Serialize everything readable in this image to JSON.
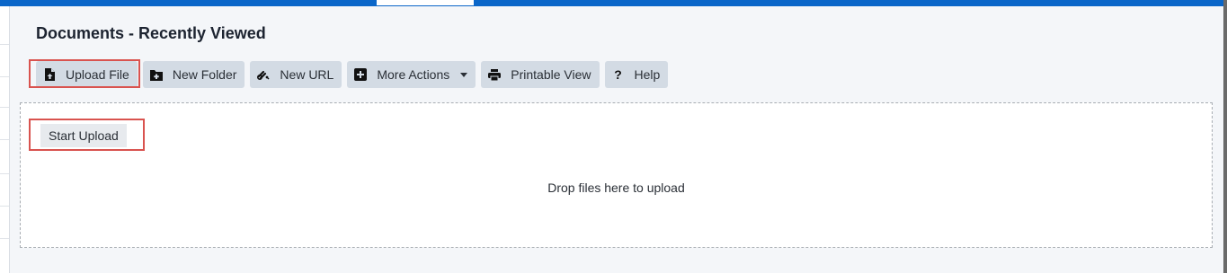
{
  "header": {
    "title": "Documents - Recently Viewed"
  },
  "toolbar": {
    "upload_file": "Upload File",
    "new_folder": "New Folder",
    "new_url": "New URL",
    "more_actions": "More Actions",
    "printable_view": "Printable View",
    "help": "Help"
  },
  "dropzone": {
    "start_upload": "Start Upload",
    "drop_text": "Drop files here to upload"
  },
  "colors": {
    "accent_bar": "#0a66c9",
    "highlight": "#d9534f",
    "button_bg": "#d3dbe4"
  },
  "icons": {
    "upload_file": "upload-file-icon",
    "new_folder": "new-folder-icon",
    "new_url": "link-icon",
    "more_actions": "plus-square-icon",
    "printable_view": "printer-icon",
    "help": "question-mark-icon"
  }
}
